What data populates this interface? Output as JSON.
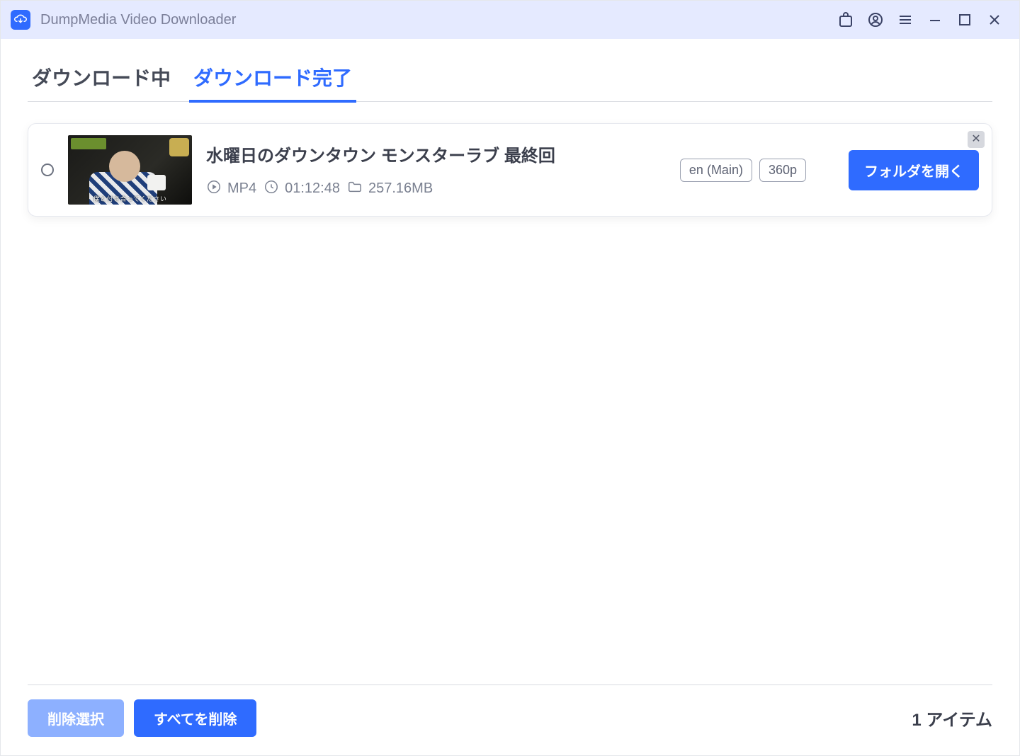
{
  "app": {
    "title": "DumpMedia Video Downloader"
  },
  "tabs": {
    "downloading": "ダウンロード中",
    "finished": "ダウンロード完了"
  },
  "item": {
    "title": "水曜日のダウンタウン モンスターラブ 最終回",
    "format": "MP4",
    "duration": "01:12:48",
    "size": "257.16MB",
    "lang_badge": "en (Main)",
    "quality_badge": "360p",
    "open_folder": "フォルダを開く",
    "thumb_caption": "僕と付き合ってください"
  },
  "footer": {
    "delete_selected": "削除選択",
    "delete_all": "すべてを削除",
    "count_label": "1 アイテム"
  }
}
